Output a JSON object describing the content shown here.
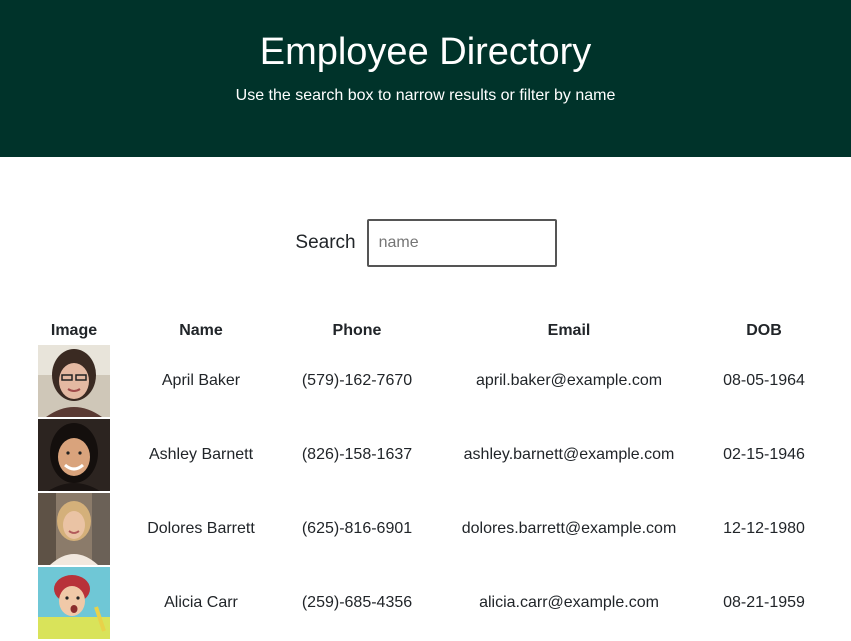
{
  "header": {
    "title": "Employee Directory",
    "subtitle": "Use the search box to narrow results or filter by name"
  },
  "search": {
    "label": "Search",
    "placeholder": "name",
    "value": ""
  },
  "table": {
    "columns": [
      "Image",
      "Name",
      "Phone",
      "Email",
      "DOB"
    ],
    "rows": [
      {
        "name": "April Baker",
        "phone": "(579)-162-7670",
        "email": "april.baker@example.com",
        "dob": "08-05-1964"
      },
      {
        "name": "Ashley Barnett",
        "phone": "(826)-158-1637",
        "email": "ashley.barnett@example.com",
        "dob": "02-15-1946"
      },
      {
        "name": "Dolores Barrett",
        "phone": "(625)-816-6901",
        "email": "dolores.barrett@example.com",
        "dob": "12-12-1980"
      },
      {
        "name": "Alicia Carr",
        "phone": "(259)-685-4356",
        "email": "alicia.carr@example.com",
        "dob": "08-21-1959"
      }
    ]
  },
  "colors": {
    "header_bg": "#00332a",
    "header_text": "#ffffff"
  }
}
